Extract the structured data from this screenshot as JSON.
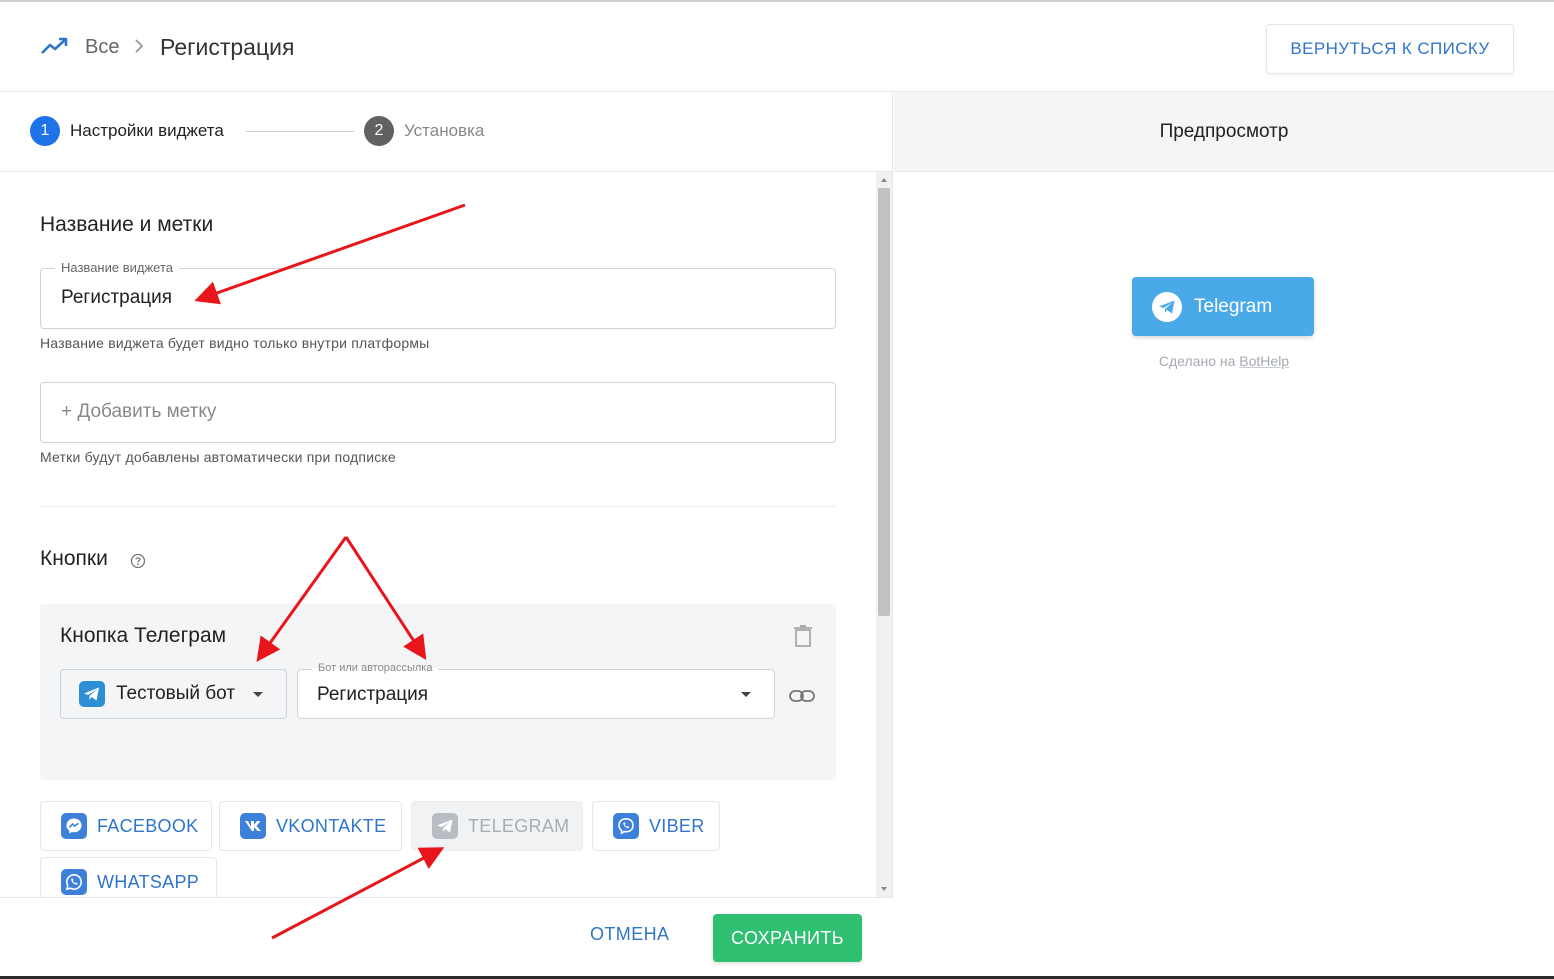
{
  "breadcrumb": {
    "root": "Все",
    "current": "Регистрация"
  },
  "header": {
    "back_label": "ВЕРНУТЬСЯ К СПИСКУ"
  },
  "stepper": {
    "steps": [
      {
        "number": "1",
        "label": "Настройки виджета"
      },
      {
        "number": "2",
        "label": "Установка"
      }
    ]
  },
  "name_section": {
    "title": "Название и метки",
    "name_field": {
      "legend": "Название виджета",
      "value": "Регистрация",
      "helper": "Название виджета будет видно только внутри платформы"
    },
    "tag_field": {
      "placeholder": "+ Добавить метку",
      "helper": "Метки будут добавлены автоматически при подписке"
    }
  },
  "buttons_section": {
    "title": "Кнопки",
    "card": {
      "title": "Кнопка Телеграм",
      "bot_select": "Тестовый бот",
      "flow_legend": "Бот или авторассылка",
      "flow_value": "Регистрация"
    },
    "channels": [
      {
        "label": "FACEBOOK",
        "icon": "messenger-icon",
        "disabled": false
      },
      {
        "label": "VKONTAKTE",
        "icon": "vk-icon",
        "disabled": false
      },
      {
        "label": "TELEGRAM",
        "icon": "telegram-icon",
        "disabled": true
      },
      {
        "label": "VIBER",
        "icon": "viber-icon",
        "disabled": false
      },
      {
        "label": "WHATSAPP",
        "icon": "whatsapp-icon",
        "disabled": false
      }
    ]
  },
  "footer": {
    "cancel_label": "ОТМЕНА",
    "save_label": "СОХРАНИТЬ"
  },
  "preview": {
    "title": "Предпросмотр",
    "button_label": "Telegram",
    "made_by_prefix": "Сделано на",
    "made_by_brand": "BotHelp"
  },
  "colors": {
    "accent": "#2f75c9",
    "save": "#2fbf71",
    "telegram": "#4aa9e8",
    "step_active": "#1e73e8",
    "annotation": "#e8161b"
  }
}
